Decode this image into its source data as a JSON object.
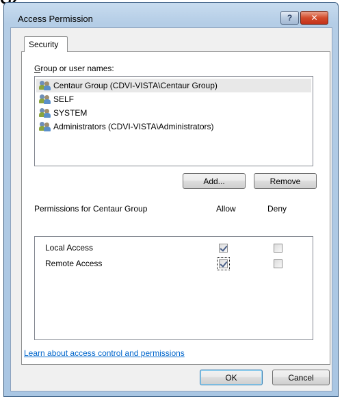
{
  "fragment_text": "ĞZ",
  "window": {
    "title": "Access Permission",
    "help_label": "?",
    "close_label": "✕"
  },
  "tabs": [
    {
      "label": "Security"
    }
  ],
  "groups": {
    "label": "Group or user names:",
    "items": [
      {
        "label": "Centaur Group (CDVI-VISTA\\Centaur Group)",
        "icon": "users-icon",
        "selected": true
      },
      {
        "label": "SELF",
        "icon": "users-icon"
      },
      {
        "label": "SYSTEM",
        "icon": "users-icon"
      },
      {
        "label": "Administrators (CDVI-VISTA\\Administrators)",
        "icon": "users-icon"
      }
    ]
  },
  "buttons": {
    "add": "Add...",
    "remove": "Remove",
    "ok": "OK",
    "cancel": "Cancel"
  },
  "permissions": {
    "label": "Permissions for Centaur Group",
    "allow_header": "Allow",
    "deny_header": "Deny",
    "rows": [
      {
        "name": "Local Access",
        "allow": true,
        "deny": false
      },
      {
        "name": "Remote Access",
        "allow": true,
        "deny": false
      }
    ]
  },
  "link": {
    "text": "Learn about access control and permissions"
  }
}
